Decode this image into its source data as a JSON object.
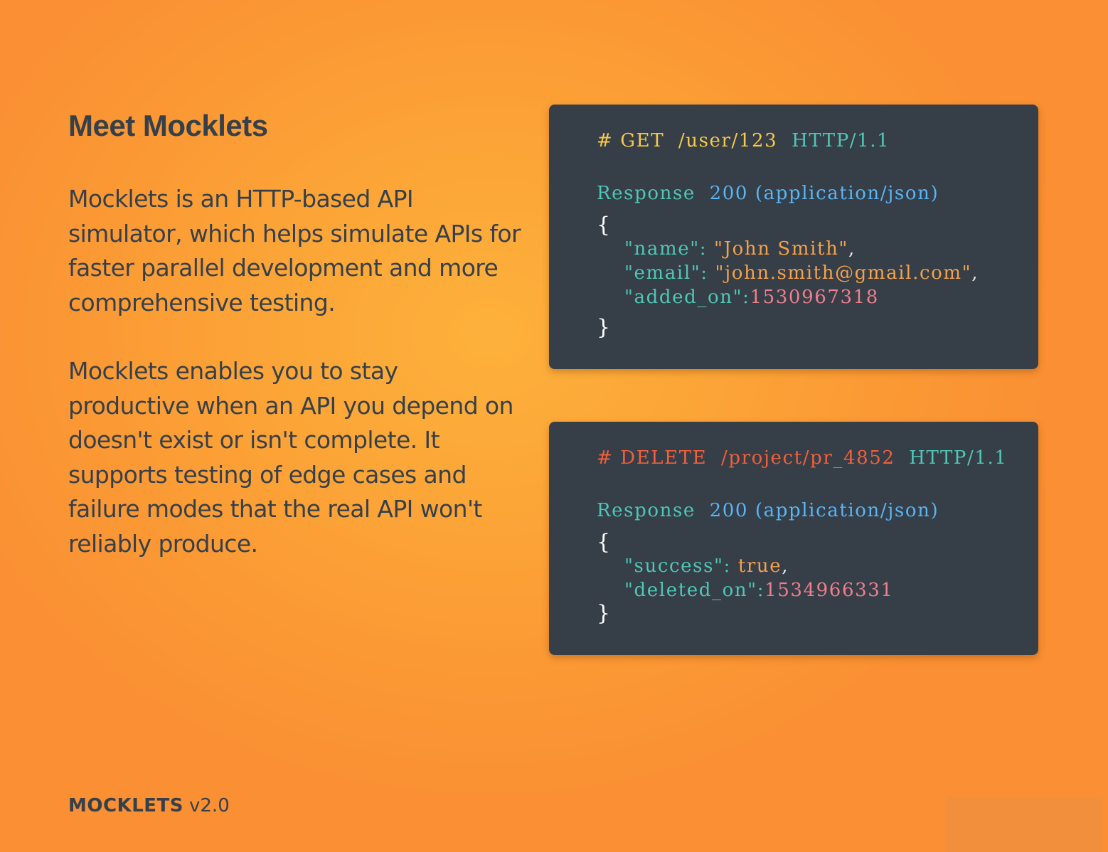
{
  "title": "Meet Mocklets",
  "paragraphs": [
    "Mocklets is an HTTP-based API simulator, which helps simulate APIs for faster parallel development and more comprehensive testing.",
    "Mocklets enables you to stay productive when an API you depend on doesn't exist or isn't complete. It supports testing of edge cases and failure modes that the real API won't reliably produce."
  ],
  "cards": [
    {
      "method": "# GET",
      "path": "/user/123",
      "protocol": "HTTP/1.1",
      "response_label": "Response",
      "status": "200 (application/json)",
      "open_brace": "{",
      "close_brace": "}",
      "fields": [
        {
          "key": "\"name\":",
          "value": "\"John Smith\"",
          "sep": ","
        },
        {
          "key": "\"email\":",
          "value": "\"john.smith@gmail.com\"",
          "sep": ","
        },
        {
          "key": "\"added_on\":",
          "value": "1530967318",
          "sep": ""
        }
      ]
    },
    {
      "method": "# DELETE",
      "path": "/project/pr_4852",
      "protocol": "HTTP/1.1",
      "response_label": "Response",
      "status": "200 (application/json)",
      "open_brace": "{",
      "close_brace": "}",
      "fields": [
        {
          "key": "\"success\":",
          "value": "true",
          "sep": ","
        },
        {
          "key": "\"deleted_on\":",
          "value": "1534966331",
          "sep": ""
        }
      ]
    }
  ],
  "footer": {
    "brand": "MOCKLETS",
    "version": "v2.0"
  },
  "colors": {
    "background": "#fca437",
    "card": "#363e48",
    "text": "#36404a"
  }
}
